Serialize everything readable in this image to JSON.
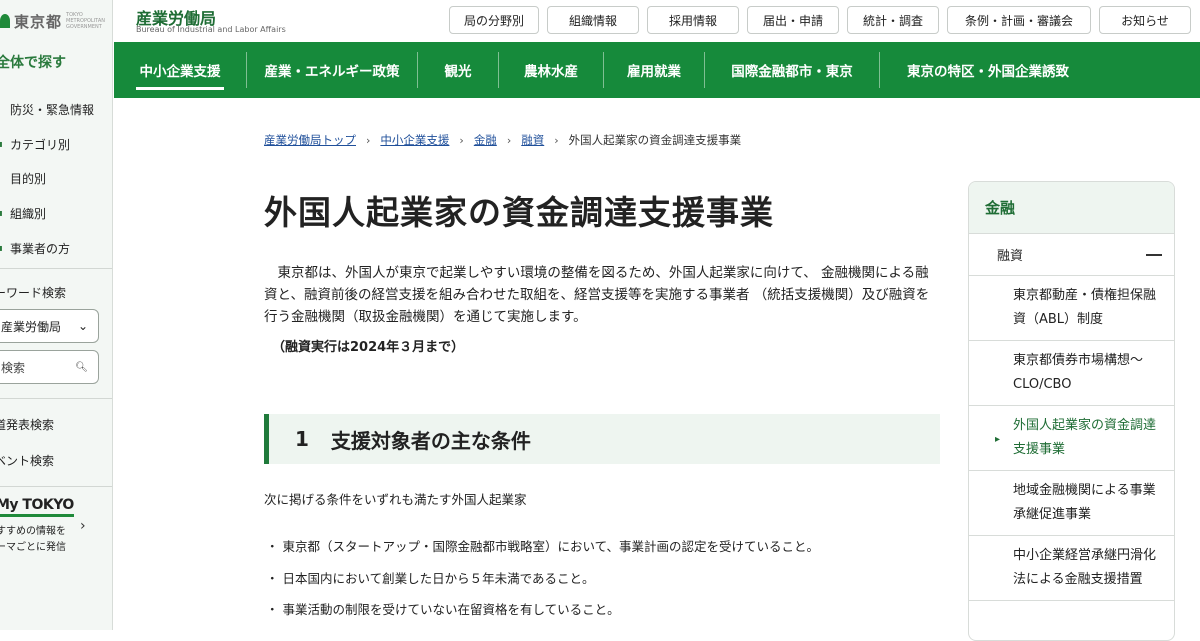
{
  "sidebar": {
    "logo_text": "東京都",
    "logo_sub": "TOKYO METROPOLITAN GOVERNMENT",
    "section_title": "全体で探す",
    "items": [
      {
        "label": "防災・緊急情報",
        "icon": "warning-icon"
      },
      {
        "label": "カテゴリ別",
        "icon": "category-icon"
      },
      {
        "label": "目的別",
        "icon": "purpose-icon"
      },
      {
        "label": "組織別",
        "icon": "org-icon"
      },
      {
        "label": "事業者の方",
        "icon": "business-icon"
      }
    ],
    "keyword_label": "ーワード検索",
    "select_value": "産業労働局",
    "search_placeholder": "検索",
    "link_press": "道発表検索",
    "link_event": "ベント検索",
    "mytokyo_title": "My TOKYO",
    "mytokyo_desc": "すすめの情報を ーマごとに発信"
  },
  "header": {
    "org_name": "産業労働局",
    "org_sub": "Bureau of Industrial and Labor Affairs",
    "nav": [
      "局の分野別",
      "組織情報",
      "採用情報",
      "届出・申請",
      "統計・調査",
      "条例・計画・審議会",
      "お知らせ"
    ]
  },
  "main_nav": [
    "中小企業支援",
    "産業・エネルギー政策",
    "観光",
    "農林水産",
    "雇用就業",
    "国際金融都市・東京",
    "東京の特区・外国企業誘致"
  ],
  "breadcrumb": {
    "links": [
      "産業労働局トップ",
      "中小企業支援",
      "金融",
      "融資"
    ],
    "current": "外国人起業家の資金調達支援事業"
  },
  "page": {
    "title": "外国人起業家の資金調達支援事業",
    "lead": "東京都は、外国人が東京で起業しやすい環境の整備を図るため、外国人起業家に向けて、 金融機関による融資と、融資前後の経営支援を組み合わせた取組を、経営支援等を実施する事業者 （統括支援機関）及び融資を行う金融機関（取扱金融機関）を通じて実施します。",
    "lead_note": "（融資実行は2024年３月まで）",
    "section1_num": "1",
    "section1_title": "支援対象者の主な条件",
    "section1_intro": "次に掲げる条件をいずれも満たす外国人起業家",
    "conditions": [
      "東京都（スタートアップ・国際金融都市戦略室）において、事業計画の認定を受けていること。",
      "日本国内において創業した日から５年未満であること。",
      "事業活動の制限を受けていない在留資格を有していること。"
    ]
  },
  "right_panel": {
    "heading": "金融",
    "sub": "融資",
    "items": [
      {
        "label": "東京都動産・債権担保融資（ABL）制度",
        "active": false
      },
      {
        "label": "東京都債券市場構想～CLO/CBO",
        "active": false
      },
      {
        "label": "外国人起業家の資金調達支援事業",
        "active": true
      },
      {
        "label": "地域金融機関による事業承継促進事業",
        "active": false
      },
      {
        "label": "中小企業経営承継円滑化法による金融支援措置",
        "active": false
      }
    ]
  },
  "colors": {
    "brand_green": "#168a3b",
    "dark_green": "#1f6d35",
    "link_blue": "#1f4f9a"
  }
}
